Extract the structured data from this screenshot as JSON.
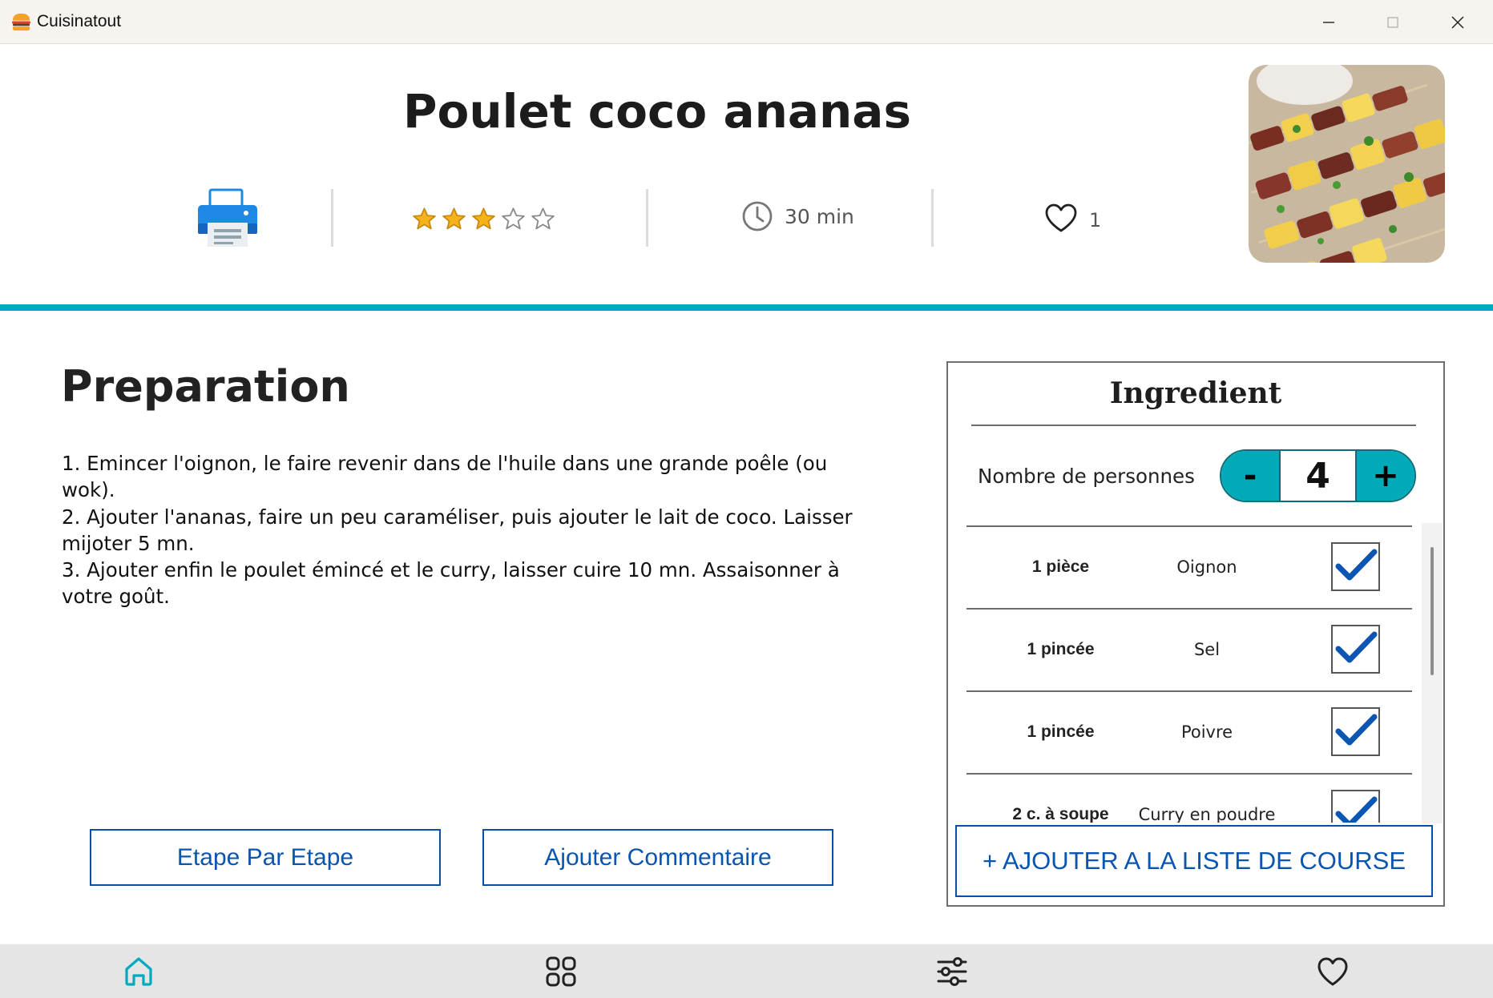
{
  "window": {
    "title": "Cuisinatout",
    "controls": [
      "minimize",
      "maximize",
      "close"
    ]
  },
  "recipe": {
    "title": "Poulet coco ananas",
    "rating": 3,
    "rating_max": 5,
    "time": "30 min",
    "likes": "1"
  },
  "preparation": {
    "heading": "Preparation",
    "steps": [
      "1. Emincer l'oignon, le faire revenir dans de l'huile dans une grande poêle (ou wok).",
      "2. Ajouter l'ananas, faire un peu caraméliser, puis ajouter le lait de coco. Laisser mijoter 5 mn.",
      "3. Ajouter enfin le poulet émincé et le curry, laisser cuire 10 mn. Assaisonner à votre goût."
    ]
  },
  "actions": {
    "step_by_step": "Etape Par Etape",
    "add_comment": "Ajouter Commentaire"
  },
  "ingredients": {
    "title": "Ingredient",
    "persons_label": "Nombre de personnes",
    "persons_value": "4",
    "minus_label": "-",
    "plus_label": "+",
    "items": [
      {
        "qty": "1 pièce",
        "name": "Oignon",
        "checked": true
      },
      {
        "qty": "1 pincée",
        "name": "Sel",
        "checked": true
      },
      {
        "qty": "1 pincée",
        "name": "Poivre",
        "checked": true
      },
      {
        "qty": "2 c. à soupe",
        "name": "Curry en poudre",
        "checked": true
      }
    ],
    "add_to_list": "+ AJOUTER A LA LISTE DE COURSE"
  },
  "nav": {
    "items": [
      "home-icon",
      "grid-icon",
      "filters-icon",
      "favorites-icon"
    ],
    "active": "home-icon"
  },
  "colors": {
    "accent": "#00aabe",
    "button_text": "#0a55b0",
    "check": "#0b56b3",
    "star": "#f5b21b"
  }
}
